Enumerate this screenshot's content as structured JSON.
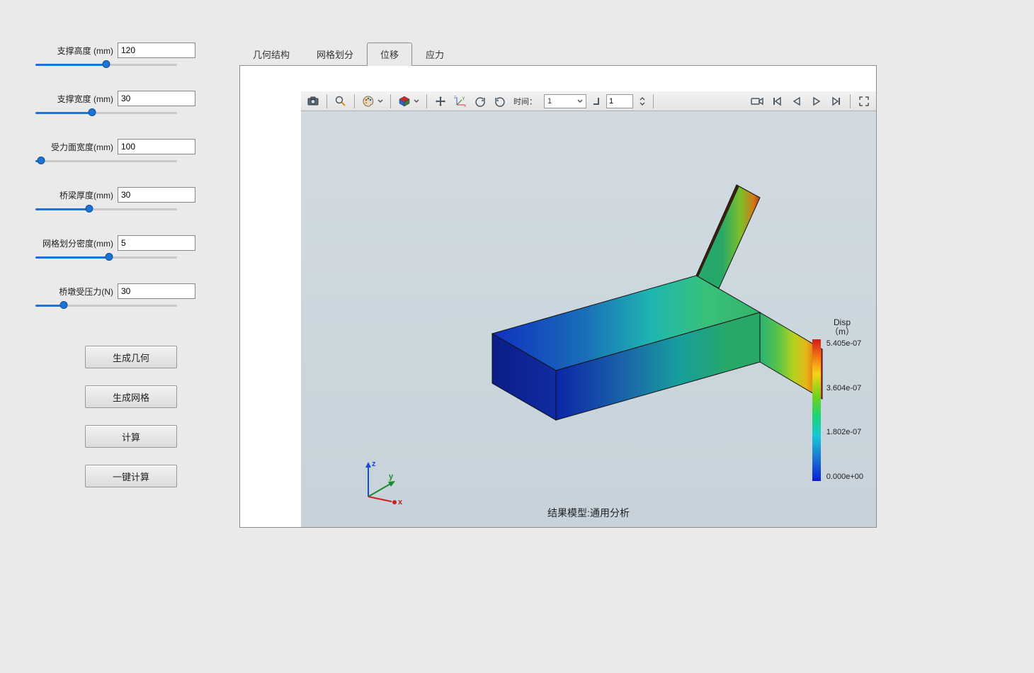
{
  "sidebar": {
    "params": [
      {
        "label": "支撑高度 (mm)",
        "value": "120",
        "fill": "50%"
      },
      {
        "label": "支撑宽度 (mm)",
        "value": "30",
        "fill": "40%"
      },
      {
        "label": "受力面宽度(mm)",
        "value": "100",
        "fill": "4%"
      },
      {
        "label": "桥梁厚度(mm)",
        "value": "30",
        "fill": "38%"
      },
      {
        "label": "网格划分密度(mm)",
        "value": "5",
        "fill": "52%"
      },
      {
        "label": "桥墩受压力(N)",
        "value": "30",
        "fill": "20%"
      }
    ],
    "buttons": {
      "gen_geometry": "生成几何",
      "gen_mesh": "生成网格",
      "calc": "计算",
      "one_click": "一键计算"
    }
  },
  "tabs": {
    "items": [
      {
        "label": "几何结构"
      },
      {
        "label": "网格划分"
      },
      {
        "label": "位移",
        "active": true
      },
      {
        "label": "应力"
      }
    ]
  },
  "toolbar": {
    "time_label": "时间：",
    "time_select": "1",
    "step_input": "1"
  },
  "viewport": {
    "title": "结果模型:通用分析",
    "triad": {
      "x": "x",
      "y": "y",
      "z": "z"
    }
  },
  "legend": {
    "title_line1": "Disp",
    "title_line2": "（m）",
    "ticks": [
      "5.405e-07",
      "3.604e-07",
      "1.802e-07",
      "0.000e+00"
    ]
  },
  "chart_data": {
    "type": "heatmap",
    "title": "Disp （m）",
    "colormap": "rainbow",
    "range": [
      0.0,
      5.405e-07
    ],
    "tick_values": [
      0.0,
      1.802e-07,
      3.604e-07,
      5.405e-07
    ],
    "tick_labels": [
      "0.000e+00",
      "1.802e-07",
      "3.604e-07",
      "5.405e-07"
    ],
    "field": "displacement_magnitude",
    "units": "m",
    "geometry": "T-shaped_extruded_solid",
    "note": "3D FE displacement contour; color indicates |u| on solid surface"
  }
}
